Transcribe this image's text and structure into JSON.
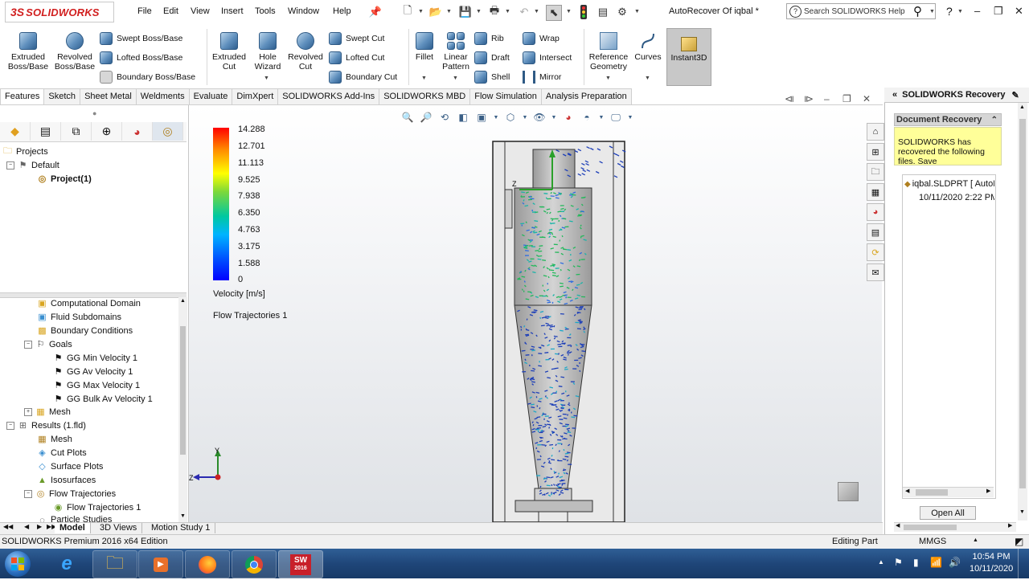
{
  "app": {
    "brand_ds": "3S",
    "brand_name": "SOLIDWORKS",
    "document_title": "AutoRecover Of iqbal *"
  },
  "menu": [
    "File",
    "Edit",
    "View",
    "Insert",
    "Tools",
    "Window",
    "Help"
  ],
  "search": {
    "placeholder": "Search SOLIDWORKS Help"
  },
  "help_glyph": "?",
  "window_controls": {
    "minimize": "–",
    "restore": "❐",
    "close": "✕"
  },
  "ribbon": {
    "extruded_boss": "Extruded\nBoss/Base",
    "revolved_boss": "Revolved\nBoss/Base",
    "swept_boss": "Swept Boss/Base",
    "lofted_boss": "Lofted Boss/Base",
    "boundary_boss": "Boundary Boss/Base",
    "extruded_cut": "Extruded\nCut",
    "hole_wizard": "Hole\nWizard",
    "revolved_cut": "Revolved\nCut",
    "swept_cut": "Swept Cut",
    "lofted_cut": "Lofted Cut",
    "boundary_cut": "Boundary Cut",
    "fillet": "Fillet",
    "linear_pattern": "Linear\nPattern",
    "rib": "Rib",
    "draft": "Draft",
    "shell": "Shell",
    "wrap": "Wrap",
    "intersect": "Intersect",
    "mirror": "Mirror",
    "reference_geometry": "Reference\nGeometry",
    "curves": "Curves",
    "instant3d": "Instant3D"
  },
  "tabs": [
    "Features",
    "Sketch",
    "Sheet Metal",
    "Weldments",
    "Evaluate",
    "DimXpert",
    "SOLIDWORKS Add-Ins",
    "SOLIDWORKS MBD",
    "Flow Simulation",
    "Analysis Preparation"
  ],
  "tree_top": {
    "projects": "Projects",
    "default": "Default",
    "project1": "Project(1)"
  },
  "tree": {
    "computational_domain": "Computational Domain",
    "fluid_subdomains": "Fluid Subdomains",
    "boundary_conditions": "Boundary Conditions",
    "goals": "Goals",
    "gg_min": "GG Min Velocity 1",
    "gg_av": "GG Av Velocity 1",
    "gg_max": "GG Max Velocity 1",
    "gg_bulk": "GG Bulk Av Velocity 1",
    "mesh1": "Mesh",
    "results": "Results (1.fld)",
    "mesh2": "Mesh",
    "cut_plots": "Cut Plots",
    "surface_plots": "Surface Plots",
    "isosurfaces": "Isosurfaces",
    "flow_trajectories": "Flow Trajectories",
    "flow_trajectories_1": "Flow Trajectories 1",
    "particle_studies": "Particle Studies"
  },
  "bottom_tabs": [
    "Model",
    "3D Views",
    "Motion Study 1"
  ],
  "legend": {
    "ticks": [
      "14.288",
      "12.701",
      "11.113",
      "9.525",
      "7.938",
      "6.350",
      "4.763",
      "3.175",
      "1.588",
      "0"
    ],
    "quantity": "Velocity [m/s]",
    "plot_name": "Flow Trajectories 1"
  },
  "triad": {
    "y": "Y",
    "z": "Z",
    "model_z": "Z"
  },
  "recovery": {
    "title": "SOLIDWORKS Recovery",
    "section": "Document Recovery",
    "message": "SOLIDWORKS has recovered the following files. Save",
    "file_name": "iqbal.SLDPRT [ AutoRecover ]",
    "file_date": "10/11/2020 2:22 PM",
    "open_all": "Open All"
  },
  "status": {
    "left": "SOLIDWORKS Premium 2016 x64 Edition",
    "mode": "Editing Part",
    "units": "MMGS"
  },
  "taskbar": {
    "sw_badge": "SW",
    "sw_year": "2016",
    "time": "10:54 PM",
    "date": "10/11/2020"
  },
  "colors": {
    "accent": "#d11f1f",
    "legend_max": "#ff0000",
    "legend_min": "#0000ff",
    "taskbar": "#1f4679",
    "recovery_note": "#ffff99"
  }
}
